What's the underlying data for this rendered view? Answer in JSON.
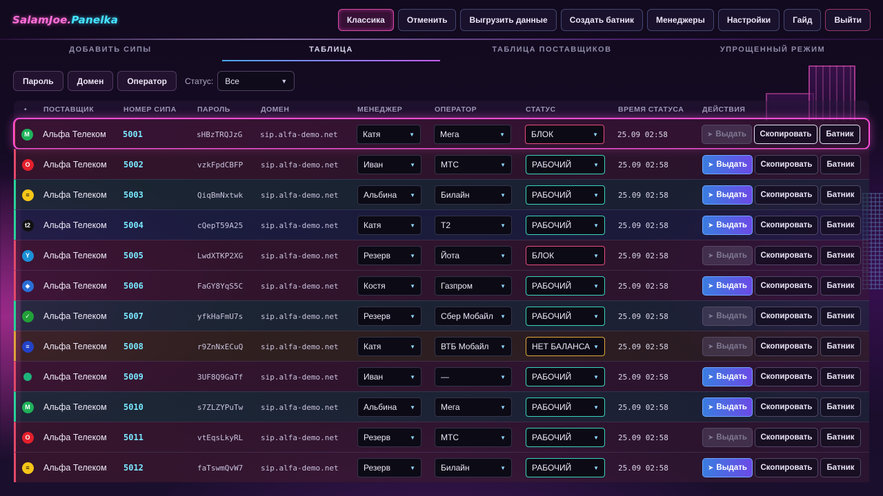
{
  "app": {
    "logo_part1": "SalamJoe.",
    "logo_part2": "Panelka"
  },
  "topnav": [
    {
      "label": "Классика",
      "active": true
    },
    {
      "label": "Отменить"
    },
    {
      "label": "Выгрузить данные"
    },
    {
      "label": "Создать батник"
    },
    {
      "label": "Менеджеры"
    },
    {
      "label": "Настройки"
    },
    {
      "label": "Гайд"
    },
    {
      "label": "Выйти",
      "danger": true
    }
  ],
  "tabs": [
    {
      "label": "ДОБАВИТЬ СИПЫ"
    },
    {
      "label": "ТАБЛИЦА",
      "active": true
    },
    {
      "label": "ТАБЛИЦА ПОСТАВЩИКОВ"
    },
    {
      "label": "УПРОЩЕННЫЙ РЕЖИМ"
    }
  ],
  "filters": {
    "buttons": [
      "Пароль",
      "Домен",
      "Оператор"
    ],
    "status_label": "Статус:",
    "status_value": "Все"
  },
  "table": {
    "headers": {
      "dot": "•",
      "provider": "ПОСТАВЩИК",
      "number": "НОМЕР СИПА",
      "password": "ПАРОЛЬ",
      "domain": "ДОМЕН",
      "manager": "МЕНЕДЖЕР",
      "operator": "ОПЕРАТОР",
      "status": "СТАТУС",
      "status_time": "ВРЕМЯ СТАТУСА",
      "actions": "ДЕЙСТВИЯ"
    },
    "actions": {
      "issue": "Выдать",
      "copy": "Скопировать",
      "batch": "Батник"
    },
    "rows": [
      {
        "provider": "Альфа Телеком",
        "number": "5001",
        "password": "sHBzTRQJzG",
        "domain": "sip.alfa-demo.net",
        "manager": "Катя",
        "operator": "Мега",
        "status": "БЛОК",
        "time": "25.09 02:58",
        "icon": "mega-icon",
        "icon_color": "#1fb25a",
        "icon_glyph": "M",
        "tone": "pink",
        "selected": true,
        "issue_enabled": false
      },
      {
        "provider": "Альфа Телеком",
        "number": "5002",
        "password": "vzkFpdCBFP",
        "domain": "sip.alfa-demo.net",
        "manager": "Иван",
        "operator": "МТС",
        "status": "РАБОЧИЙ",
        "time": "25.09 02:58",
        "icon": "mts-icon",
        "icon_color": "#e3202c",
        "icon_glyph": "O",
        "tone": "red",
        "issue_enabled": true
      },
      {
        "provider": "Альфа Телеком",
        "number": "5003",
        "password": "QiqBmNxtwk",
        "domain": "sip.alfa-demo.net",
        "manager": "Альбина",
        "operator": "Билайн",
        "status": "РАБОЧИЙ",
        "time": "25.09 02:58",
        "icon": "beeline-icon",
        "icon_color": "#f5c518",
        "icon_glyph": "≡",
        "tone": "green",
        "issue_enabled": true
      },
      {
        "provider": "Альфа Телеком",
        "number": "5004",
        "password": "cQepT59A25",
        "domain": "sip.alfa-demo.net",
        "manager": "Катя",
        "operator": "Т2",
        "status": "РАБОЧИЙ",
        "time": "25.09 02:58",
        "icon": "t2-icon",
        "icon_color": "#111111",
        "icon_glyph": "t2",
        "tone": "blue",
        "issue_enabled": true
      },
      {
        "provider": "Альфа Телеком",
        "number": "5005",
        "password": "LwdXTKP2XG",
        "domain": "sip.alfa-demo.net",
        "manager": "Резерв",
        "operator": "Йота",
        "status": "БЛОК",
        "time": "25.09 02:58",
        "icon": "yota-icon",
        "icon_color": "#1c8fd6",
        "icon_glyph": "Y",
        "tone": "red",
        "issue_enabled": false
      },
      {
        "provider": "Альфа Телеком",
        "number": "5006",
        "password": "FaGY8YqS5C",
        "domain": "sip.alfa-demo.net",
        "manager": "Костя",
        "operator": "Газпром",
        "status": "РАБОЧИЙ",
        "time": "25.09 02:58",
        "icon": "gazprom-icon",
        "icon_color": "#2a6fd6",
        "icon_glyph": "◆",
        "tone": "red",
        "issue_enabled": true
      },
      {
        "provider": "Альфа Телеком",
        "number": "5007",
        "password": "yfkHaFmU7s",
        "domain": "sip.alfa-demo.net",
        "manager": "Резерв",
        "operator": "Сбер Мобайл",
        "status": "РАБОЧИЙ",
        "time": "25.09 02:58",
        "icon": "sber-icon",
        "icon_color": "#21a038",
        "icon_glyph": "✓",
        "tone": "green",
        "issue_enabled": false
      },
      {
        "provider": "Альфа Телеком",
        "number": "5008",
        "password": "r9ZnNxECuQ",
        "domain": "sip.alfa-demo.net",
        "manager": "Катя",
        "operator": "ВТБ Мобайл",
        "status": "НЕТ БАЛАНСА",
        "time": "25.09 02:58",
        "icon": "vtb-icon",
        "icon_color": "#2242c7",
        "icon_glyph": "≡",
        "tone": "yellow",
        "border": "amber",
        "issue_enabled": false
      },
      {
        "provider": "Альфа Телеком",
        "number": "5009",
        "password": "3UF8Q9GaTf",
        "domain": "sip.alfa-demo.net",
        "manager": "Иван",
        "operator": "—",
        "status": "РАБОЧИЙ",
        "time": "25.09 02:58",
        "icon": "dot-icon",
        "icon_color": "#1fb27a",
        "icon_glyph": "",
        "tone": "red",
        "issue_enabled": true
      },
      {
        "provider": "Альфа Телеком",
        "number": "5010",
        "password": "s7ZLZYPuTw",
        "domain": "sip.alfa-demo.net",
        "manager": "Альбина",
        "operator": "Мега",
        "status": "РАБОЧИЙ",
        "time": "25.09 02:58",
        "icon": "mega-icon",
        "icon_color": "#1fb25a",
        "icon_glyph": "M",
        "tone": "green",
        "issue_enabled": true
      },
      {
        "provider": "Альфа Телеком",
        "number": "5011",
        "password": "vtEqsLkyRL",
        "domain": "sip.alfa-demo.net",
        "manager": "Резерв",
        "operator": "МТС",
        "status": "РАБОЧИЙ",
        "time": "25.09 02:58",
        "icon": "mts-icon",
        "icon_color": "#e3202c",
        "icon_glyph": "O",
        "tone": "red",
        "issue_enabled": false
      },
      {
        "provider": "Альфа Телеком",
        "number": "5012",
        "password": "faTswmQvW7",
        "domain": "sip.alfa-demo.net",
        "manager": "Резерв",
        "operator": "Билайн",
        "status": "РАБОЧИЙ",
        "time": "25.09 02:58",
        "icon": "beeline-icon",
        "icon_color": "#f5c518",
        "icon_glyph": "≡",
        "tone": "red",
        "issue_enabled": true
      }
    ]
  }
}
